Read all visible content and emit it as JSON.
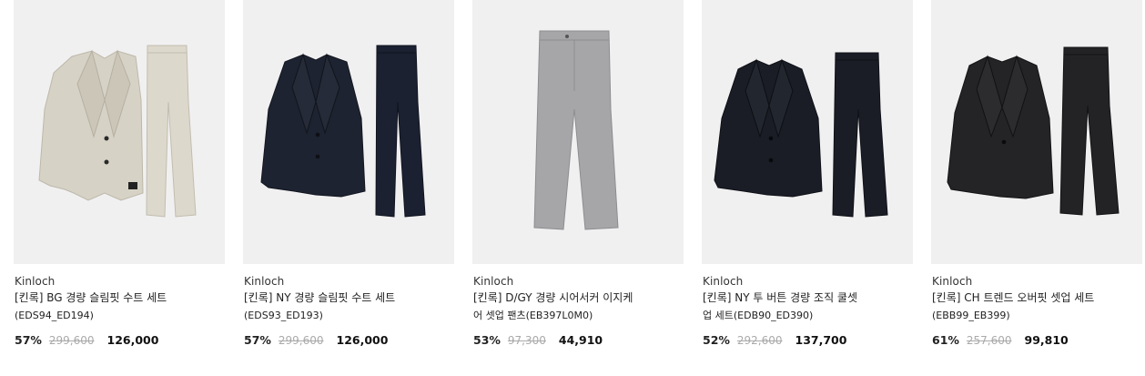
{
  "products": [
    {
      "brand": "Kinloch",
      "name_line1": "[킨록] BG 경량 슬림핏 수트 세트",
      "name_line2": "(EDS94_ED194)",
      "discount": "57%",
      "original_price": "299,600",
      "sale_price": "126,000",
      "colors": {
        "jacket": "#d6d2c5",
        "pants": "#dcd8cb"
      },
      "image": "jacket-and-pants"
    },
    {
      "brand": "Kinloch",
      "name_line1": "[킨록] NY 경량 슬림핏 수트 세트",
      "name_line2": "(EDS93_ED193)",
      "discount": "57%",
      "original_price": "299,600",
      "sale_price": "126,000",
      "colors": {
        "jacket": "#1d2330",
        "pants": "#1b2130"
      },
      "image": "jacket-and-pants"
    },
    {
      "brand": "Kinloch",
      "name_line1": "[킨록] D/GY 경량 시어서커 이지케",
      "name_line2": "어 셋업 팬츠(EB397L0M0)",
      "discount": "53%",
      "original_price": "97,300",
      "sale_price": "44,910",
      "colors": {
        "pants": "#a6a6a9"
      },
      "image": "pants-only"
    },
    {
      "brand": "Kinloch",
      "name_line1": "[킨록] NY 투 버튼 경량 조직 쿨셋",
      "name_line2": "업 세트(EDB90_ED390)",
      "discount": "52%",
      "original_price": "292,600",
      "sale_price": "137,700",
      "colors": {
        "jacket": "#1a1d26",
        "pants": "#1a1d26"
      },
      "image": "jacket-and-pants"
    },
    {
      "brand": "Kinloch",
      "name_line1": "[킨록] CH 트렌드 오버핏 셋업 세트",
      "name_line2": "(EBB99_EB399)",
      "discount": "61%",
      "original_price": "257,600",
      "sale_price": "99,810",
      "colors": {
        "jacket": "#242325",
        "pants": "#232224"
      },
      "image": "jacket-and-pants"
    }
  ]
}
